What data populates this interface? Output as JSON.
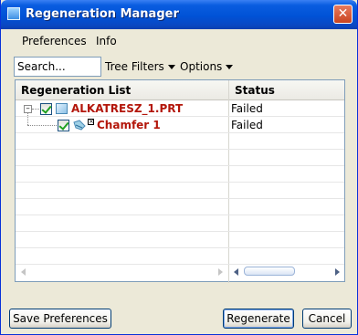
{
  "window": {
    "title": "Regeneration Manager",
    "close_glyph": "✕"
  },
  "menu": {
    "items": [
      "Preferences",
      "Info"
    ]
  },
  "toolbar": {
    "search_placeholder": "Search...",
    "tree_filters_label": "Tree Filters",
    "options_label": "Options"
  },
  "tree": {
    "columns": [
      "Regeneration List",
      "Status"
    ],
    "rows": [
      {
        "label": "ALKATRESZ_1.PRT",
        "status": "Failed",
        "icon": "part-icon",
        "checked": true,
        "level": 0
      },
      {
        "label": "Chamfer 1",
        "status": "Failed",
        "icon": "chamfer-feature-icon",
        "checked": true,
        "level": 1
      }
    ]
  },
  "buttons": {
    "save_preferences": "Save Preferences",
    "regenerate": "Regenerate",
    "cancel": "Cancel"
  },
  "colors": {
    "titlebar": "#0052d6",
    "failed_label": "#b3160a",
    "dialog_bg": "#ece9d8"
  }
}
